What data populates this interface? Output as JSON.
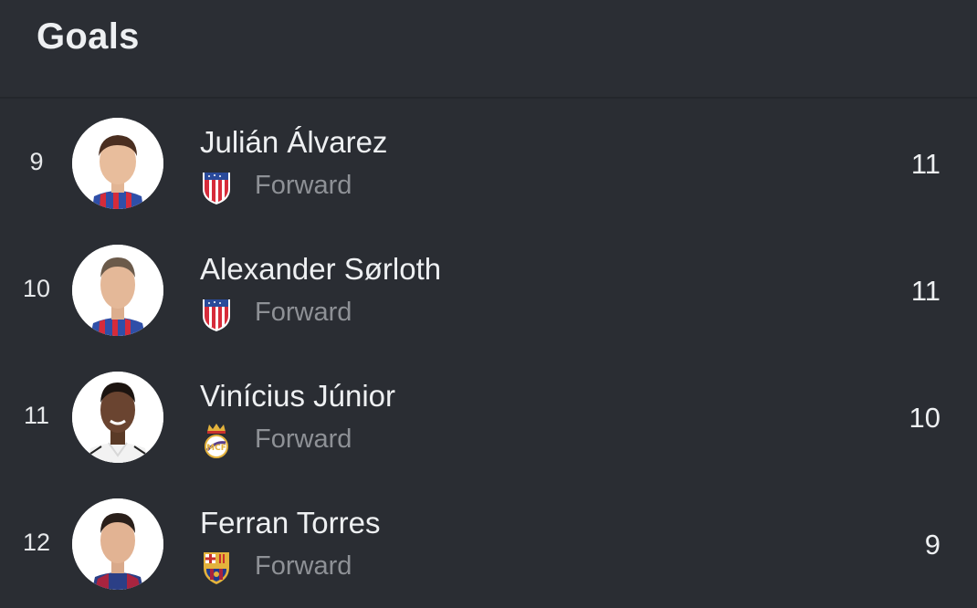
{
  "header": {
    "title": "Goals"
  },
  "players": [
    {
      "rank": "9",
      "name": "Julián Álvarez",
      "position": "Forward",
      "club_crest": "atletico-madrid-crest",
      "value": "11",
      "kit": "atletico"
    },
    {
      "rank": "10",
      "name": "Alexander Sørloth",
      "position": "Forward",
      "club_crest": "atletico-madrid-crest",
      "value": "11",
      "kit": "atletico"
    },
    {
      "rank": "11",
      "name": "Vinícius Júnior",
      "position": "Forward",
      "club_crest": "real-madrid-crest",
      "value": "10",
      "kit": "real"
    },
    {
      "rank": "12",
      "name": "Ferran Torres",
      "position": "Forward",
      "club_crest": "barcelona-crest",
      "value": "9",
      "kit": "barca"
    }
  ],
  "colors": {
    "background": "#2a2d33",
    "text_primary": "#eef0f2",
    "text_secondary": "#8e9196"
  }
}
